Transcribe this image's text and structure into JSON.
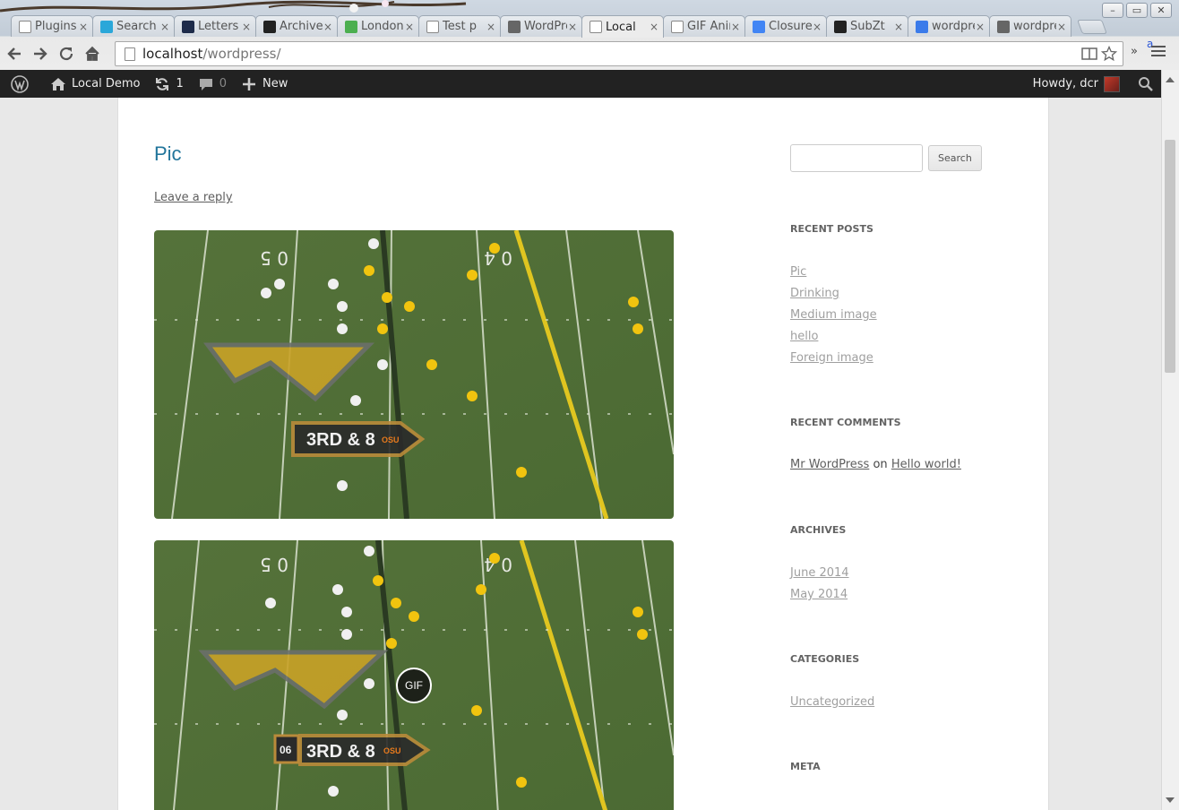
{
  "window": {
    "controls": [
      "minimize",
      "maximize",
      "close"
    ]
  },
  "tabs": [
    {
      "title": "Plugins",
      "favicon": "page-icon",
      "color": "#ffffff"
    },
    {
      "title": "Search",
      "favicon": "ai-icon",
      "color": "#2aa7d9"
    },
    {
      "title": "Letters",
      "favicon": "letters-icon",
      "color": "#1e2b4a"
    },
    {
      "title": "Archive",
      "favicon": "four-icon",
      "color": "#222222"
    },
    {
      "title": "London",
      "favicon": "maps-icon",
      "color": "#4caf50"
    },
    {
      "title": "Test p",
      "favicon": "page-icon",
      "color": "#ffffff"
    },
    {
      "title": "WordPress",
      "favicon": "wordpress-icon",
      "color": "#666666"
    },
    {
      "title": "Local",
      "favicon": "page-icon",
      "color": "#ffffff",
      "active": true
    },
    {
      "title": "GIF Animator",
      "favicon": "page-icon",
      "color": "#ffffff"
    },
    {
      "title": "Closure",
      "favicon": "google-icon",
      "color": "#4285f4"
    },
    {
      "title": "SubZt",
      "favicon": "github-icon",
      "color": "#222222"
    },
    {
      "title": "wordpress",
      "favicon": "google-search-icon",
      "color": "#3b7bea"
    },
    {
      "title": "wordpress",
      "favicon": "wordpress-icon",
      "color": "#666666"
    }
  ],
  "tab_close_glyph": "×",
  "address_bar": {
    "host": "localhost",
    "path": "/wordpress/"
  },
  "toolbar": {
    "overflow_label": "»",
    "extension_badge": "a"
  },
  "admin_bar": {
    "site_name": "Local Demo",
    "updates_count": "1",
    "comments_count": "0",
    "new_label": "New",
    "greeting": "Howdy, dcr"
  },
  "post": {
    "title": "Pic",
    "leave_reply": "Leave a reply",
    "images": [
      {
        "down_distance": "3RD & 8",
        "team": "OSU"
      },
      {
        "down_distance": "3RD & 8",
        "team": "OSU",
        "clock": "06",
        "badge": "GIF"
      }
    ]
  },
  "sidebar": {
    "search_button": "Search",
    "recent_posts_title": "RECENT POSTS",
    "recent_posts": [
      "Pic",
      "Drinking",
      "Medium image",
      "hello",
      "Foreign image"
    ],
    "recent_comments_title": "RECENT COMMENTS",
    "recent_comment": {
      "author": "Mr WordPress",
      "on": "on",
      "post": "Hello world!"
    },
    "archives_title": "ARCHIVES",
    "archives": [
      "June 2014",
      "May 2014"
    ],
    "categories_title": "CATEGORIES",
    "categories": [
      "Uncategorized"
    ],
    "meta_title": "META"
  }
}
